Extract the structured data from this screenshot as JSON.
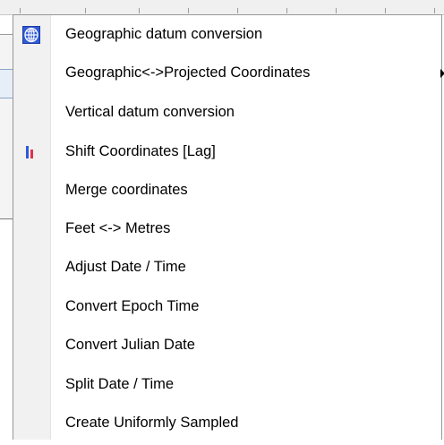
{
  "menu": {
    "items": [
      {
        "label": "Geographic datum conversion",
        "icon": "globe-grid-icon"
      },
      {
        "label": "Geographic<->Projected Coordinates",
        "submenu": true
      },
      {
        "label": "Vertical datum conversion"
      },
      {
        "label": "Shift Coordinates [Lag]",
        "icon": "shift-bars-icon"
      },
      {
        "label": "Merge coordinates"
      },
      {
        "label": "Feet <-> Metres"
      },
      {
        "label": "Adjust Date / Time"
      },
      {
        "label": "Convert Epoch Time"
      },
      {
        "label": "Convert Julian Date"
      },
      {
        "label": "Split Date / Time"
      },
      {
        "label": "Create Uniformly Sampled"
      }
    ]
  },
  "colors": {
    "menu_background": "#ffffff",
    "gutter": "#f1f1f1",
    "border": "#979797",
    "icon_blue": "#2f5ad8",
    "icon_red": "#e0314b"
  }
}
